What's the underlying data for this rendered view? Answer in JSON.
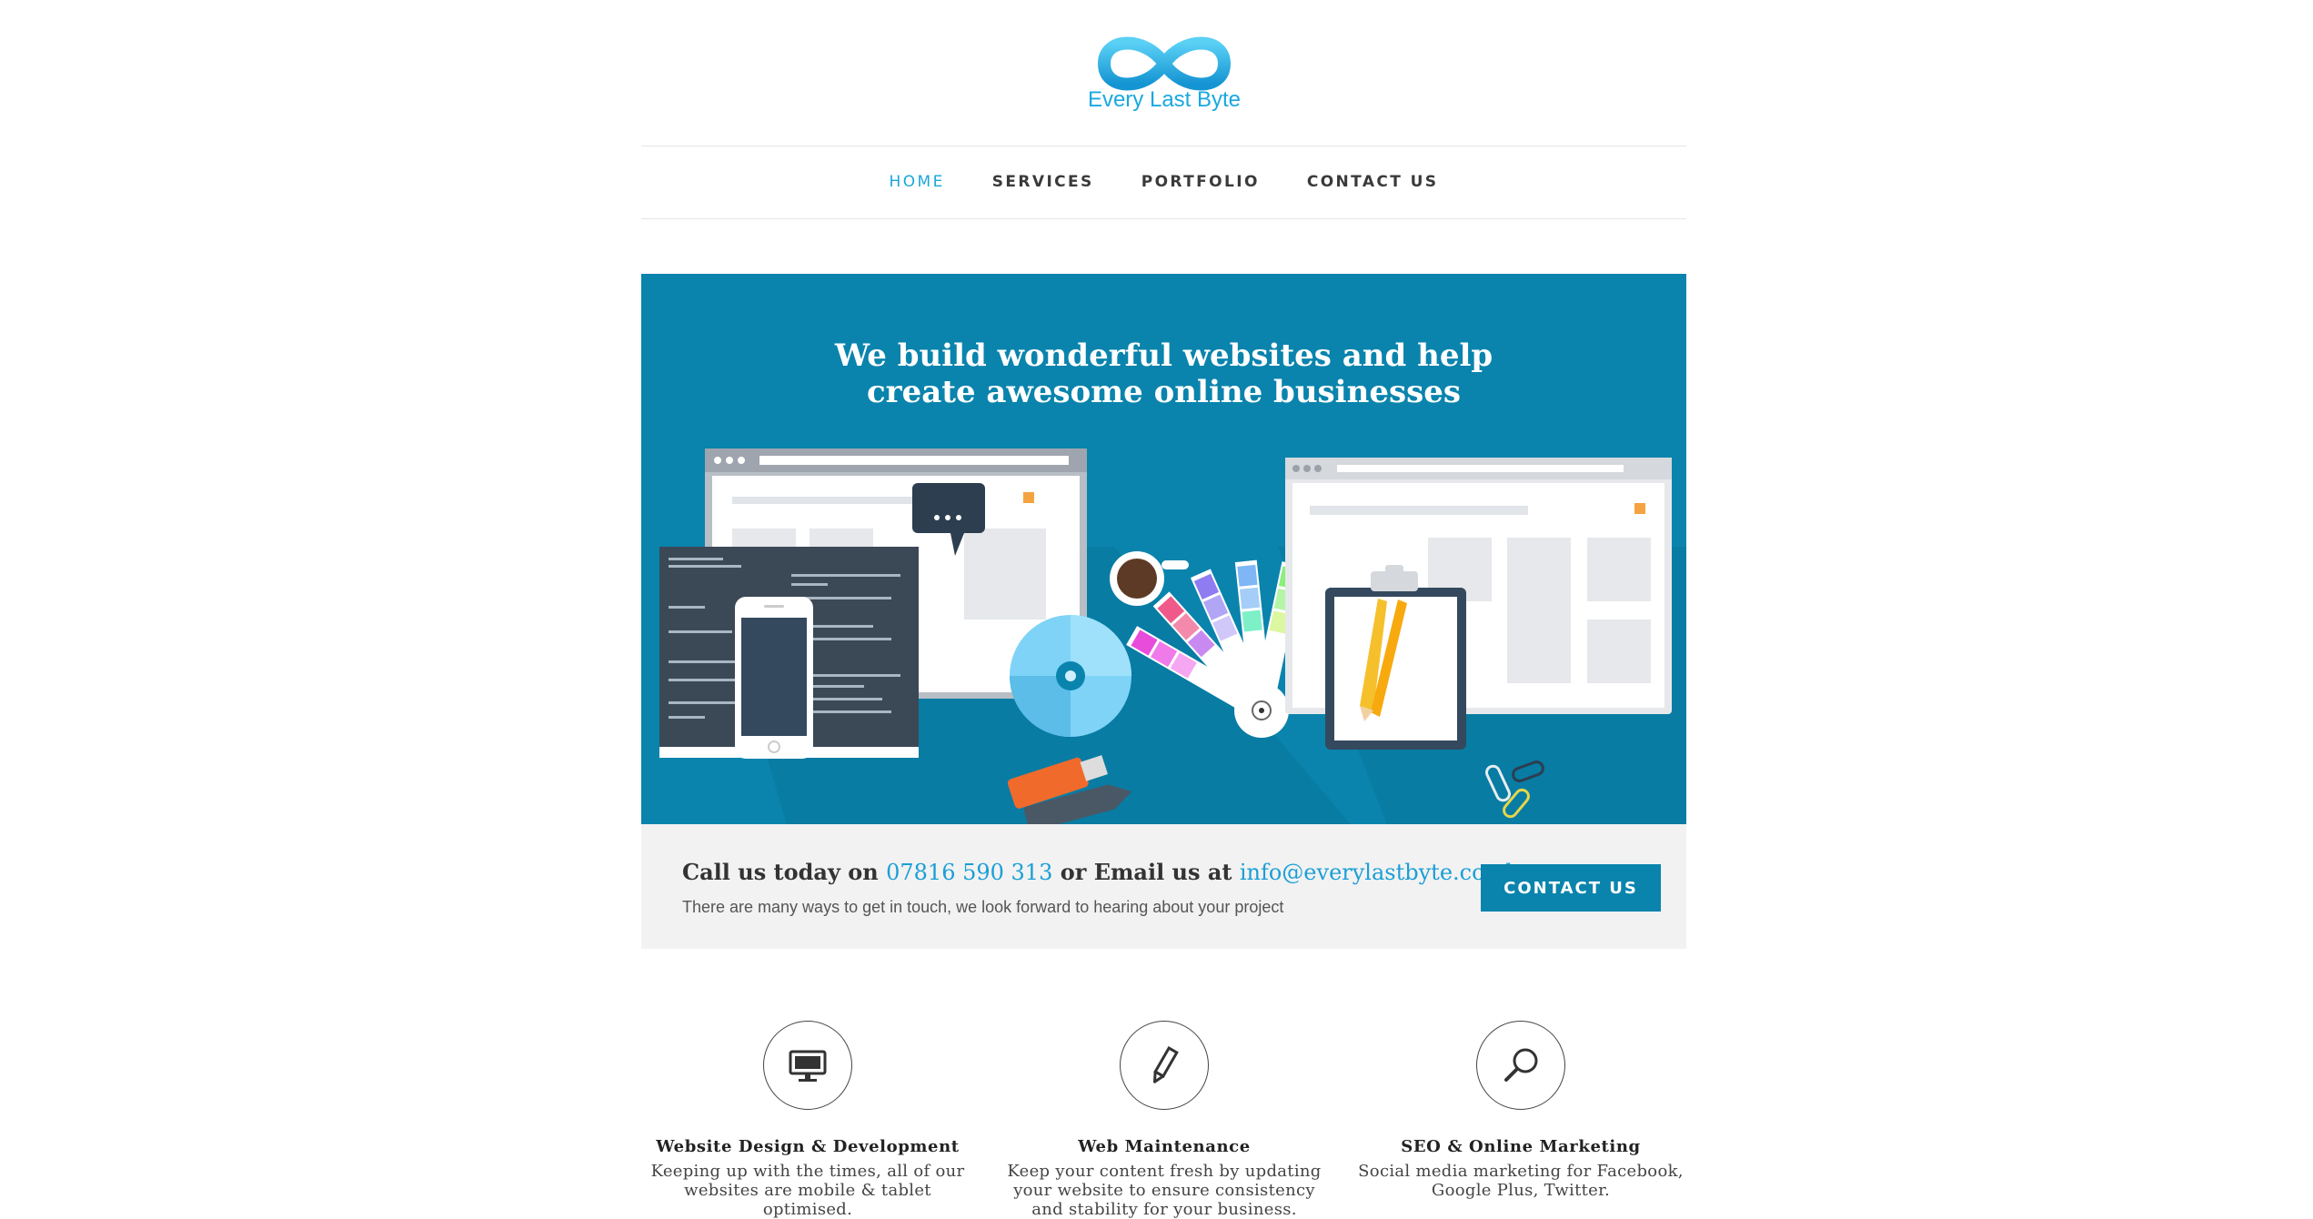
{
  "brand": {
    "name": "Every Last Byte",
    "accent": "#19a8e0",
    "primary": "#0a84ad"
  },
  "nav": {
    "items": [
      {
        "label": "HOME",
        "active": true
      },
      {
        "label": "SERVICES",
        "active": false
      },
      {
        "label": "PORTFOLIO",
        "active": false
      },
      {
        "label": "CONTACT US",
        "active": false
      }
    ]
  },
  "hero": {
    "headline_line1": "We build wonderful websites and help",
    "headline_line2": "create awesome online businesses"
  },
  "contact_strip": {
    "call_prefix": "Call us today on ",
    "phone": "07816 590 313",
    "email_prefix": " or Email us at ",
    "email": "info@everylastbyte.co.uk",
    "subtitle": "There are many ways to get in touch, we look forward to hearing about your project",
    "button_label": "CONTACT US"
  },
  "services": [
    {
      "icon": "monitor-icon",
      "title": "Website Design & Development",
      "text": "Keeping up with the times, all of our websites are mobile & tablet optimised."
    },
    {
      "icon": "pencil-icon",
      "title": "Web Maintenance",
      "text": "Keep your content fresh by updating your website to ensure consistency and stability for your business."
    },
    {
      "icon": "magnifier-icon",
      "title": "SEO & Online Marketing",
      "text": "Social media marketing for Facebook, Google Plus, Twitter."
    }
  ]
}
